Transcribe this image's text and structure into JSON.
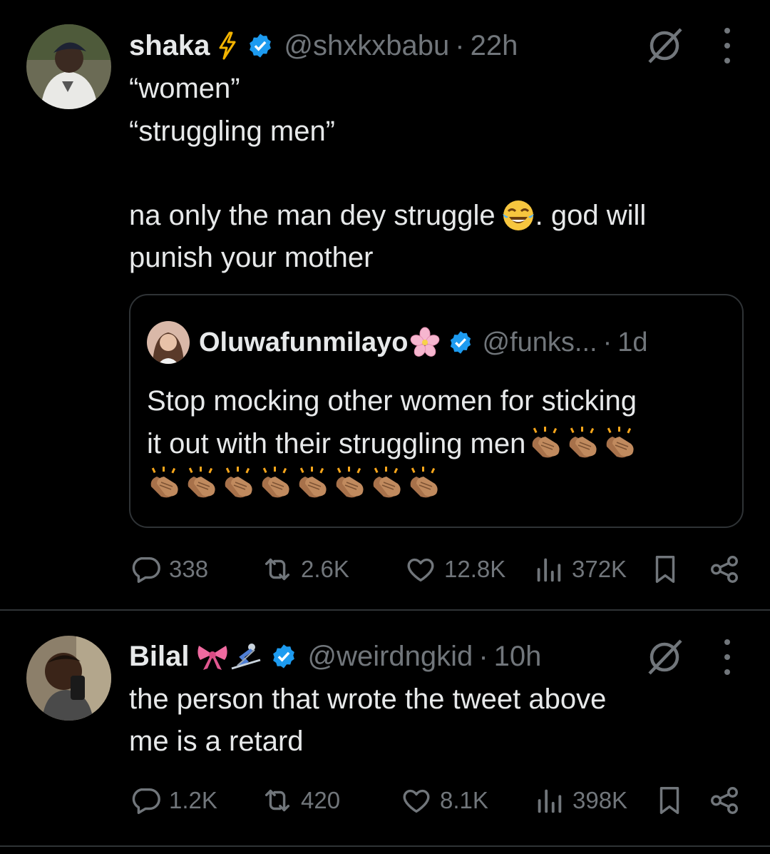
{
  "tweets": [
    {
      "author": {
        "name": "shaka",
        "emoji": "lightning-icon",
        "handle": "@shxkxbabu",
        "separator": "·",
        "time": "22h"
      },
      "text_lines": [
        "“women”",
        "“struggling men”",
        "",
        "na only the man dey struggle",
        ". god will",
        "punish your mother"
      ],
      "quote": {
        "author": {
          "name": "Oluwafunmilayo",
          "emoji": "cherry-blossom-icon",
          "handle": "@funks...",
          "separator": "·",
          "time": "1d"
        },
        "text_lines": [
          "Stop mocking other women for sticking",
          "it out with their struggling men"
        ],
        "emoji_counts": {
          "line2_claps": 3,
          "line3_claps": 8
        }
      },
      "stats": {
        "replies": "338",
        "reposts": "2.6K",
        "likes": "12.8K",
        "views": "372K"
      }
    },
    {
      "author": {
        "name": "Bilal",
        "emoji": "ribbon-and-skier-icons",
        "handle": "@weirdngkid",
        "separator": "·",
        "time": "10h"
      },
      "text_lines": [
        "the person that wrote the tweet above",
        "me is a retard"
      ],
      "stats": {
        "replies": "1.2K",
        "reposts": "420",
        "likes": "8.1K",
        "views": "398K"
      }
    }
  ],
  "colors": {
    "background": "#000000",
    "text": "#e7e9ea",
    "muted": "#71767b",
    "verified": "#1d9bf0",
    "divider": "#2f3336"
  }
}
